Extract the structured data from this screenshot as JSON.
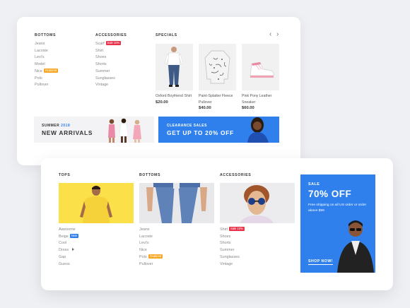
{
  "menu1": {
    "bottoms": {
      "heading": "Bottoms",
      "items": [
        "Jeans",
        "Lacoste",
        "Levi's",
        "Model",
        "Nice",
        "Polo",
        "Pullover"
      ],
      "badge_item": "Featured"
    },
    "accessories": {
      "heading": "Accessories",
      "items": [
        "Scarf",
        "Shirt",
        "Shoes",
        "Shorts",
        "Summer",
        "Sunglasses",
        "Vintage"
      ],
      "badge_item": "Sale 10%"
    },
    "specials": {
      "heading": "Specials",
      "products": [
        {
          "name": "Oxford Boyfriend Shirt",
          "price": "$20.00"
        },
        {
          "name": "Paint-Splatter Fleece Pullover",
          "price": "$40.00"
        },
        {
          "name": "Pink Pony Leather Sneaker",
          "price": "$60.00"
        }
      ]
    },
    "banner_left": {
      "season": "Summer",
      "year": "2018",
      "title": "New Arrivals"
    },
    "banner_right": {
      "sub": "Clearance Sales",
      "title": "Get up to 20% off"
    }
  },
  "menu2": {
    "tops": {
      "heading": "Tops",
      "items": [
        "Awesome",
        "Beige",
        "Cool",
        "Dress",
        "Gap",
        "Guess"
      ],
      "badge_item": "New"
    },
    "bottoms": {
      "heading": "Bottoms",
      "items": [
        "Jeans",
        "Lacoste",
        "Levi's",
        "Nice",
        "Polo",
        "Pullover"
      ],
      "badge_item": "Featured"
    },
    "accessories": {
      "heading": "Accessories",
      "items": [
        "Shirt",
        "Shoes",
        "Shorts",
        "Summer",
        "Sunglasses",
        "Vintage"
      ],
      "badge_item": "Sale 10%"
    },
    "sale": {
      "label": "Sale",
      "title": "70% off",
      "desc": "Free shipping on all US order or order above $99",
      "cta": "Shop now!"
    }
  },
  "colors": {
    "accent_blue": "#2f80ed",
    "badge_red": "#e8344b",
    "badge_orange": "#f6a623",
    "tops_yellow": "#fce04a"
  }
}
